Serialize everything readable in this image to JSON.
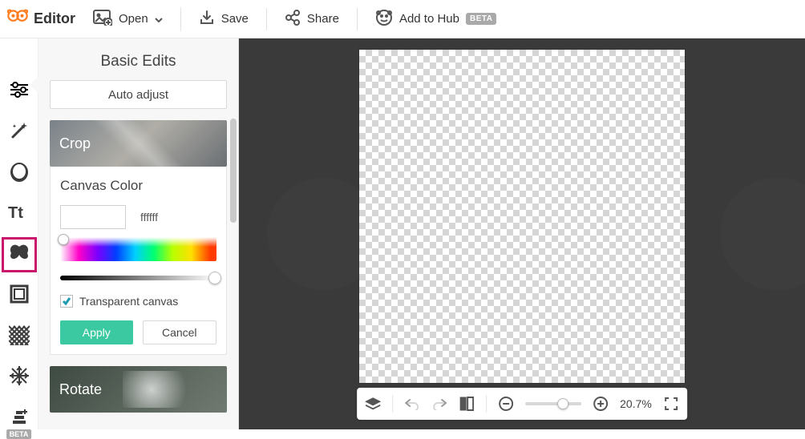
{
  "brand": {
    "name": "Editor"
  },
  "topbar": {
    "open": "Open",
    "save": "Save",
    "share": "Share",
    "add_to_hub": "Add to Hub",
    "hub_badge": "BETA"
  },
  "leftnav": {
    "items": [
      "sliders",
      "wand",
      "face",
      "text",
      "butterfly",
      "frame",
      "pattern",
      "snowflake",
      "layers-extra"
    ],
    "active": "sliders",
    "highlighted": "butterfly",
    "extra_badge": "BETA"
  },
  "panel": {
    "title": "Basic Edits",
    "auto_adjust": "Auto adjust",
    "sections": {
      "crop": {
        "label": "Crop"
      },
      "canvas_color": {
        "label": "Canvas Color",
        "hex": "ffffff",
        "transparent_label": "Transparent canvas",
        "transparent_checked": true,
        "apply": "Apply",
        "cancel": "Cancel"
      },
      "rotate": {
        "label": "Rotate"
      }
    }
  },
  "bottombar": {
    "zoom_pct": "20.7%"
  },
  "colors": {
    "accent_teal": "#21a5b7",
    "brand_orange": "#ff7a1a",
    "highlight_pink": "#c9156b",
    "apply_green": "#3bc9a2"
  }
}
